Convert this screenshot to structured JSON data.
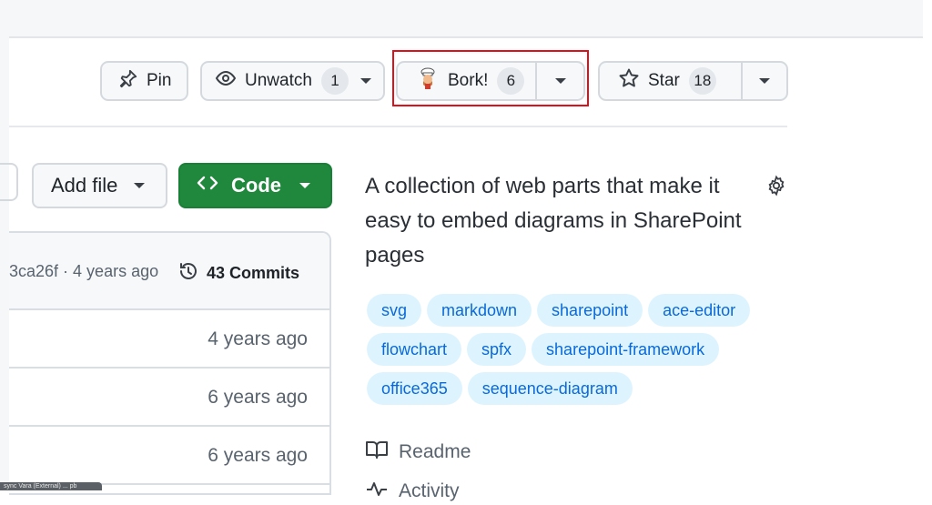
{
  "repo_header": {
    "pin_label": "Pin",
    "watch_label": "Unwatch",
    "watch_count": "1",
    "fork_label": "Bork!",
    "fork_count": "6",
    "star_label": "Star",
    "star_count": "18"
  },
  "actions": {
    "add_file_label": "Add file",
    "code_label": "Code"
  },
  "commits": {
    "latest_info": "3ca26f · 4 years ago",
    "count_label": "43 Commits"
  },
  "files": [
    {
      "age": "4 years ago"
    },
    {
      "age": "6 years ago"
    },
    {
      "age": "6 years ago"
    }
  ],
  "about": {
    "description": "A collection of web parts that make it easy to embed diagrams in SharePoint pages",
    "topics": [
      "svg",
      "markdown",
      "sharepoint",
      "ace-editor",
      "flowchart",
      "spfx",
      "sharepoint-framework",
      "office365",
      "sequence-diagram"
    ],
    "readme_label": "Readme",
    "activity_label": "Activity"
  },
  "status_bar": {
    "text": "sync Vara (External) ... pb"
  },
  "colors": {
    "accent_green": "#1f883d",
    "topic_bg": "#ddf4ff",
    "topic_text": "#0969da",
    "highlight_red": "#e0101a"
  },
  "icons": [
    "pin-icon",
    "eye-icon",
    "fork-mascot-icon",
    "star-icon",
    "code-icon",
    "history-icon",
    "gear-icon",
    "book-icon",
    "pulse-icon"
  ]
}
